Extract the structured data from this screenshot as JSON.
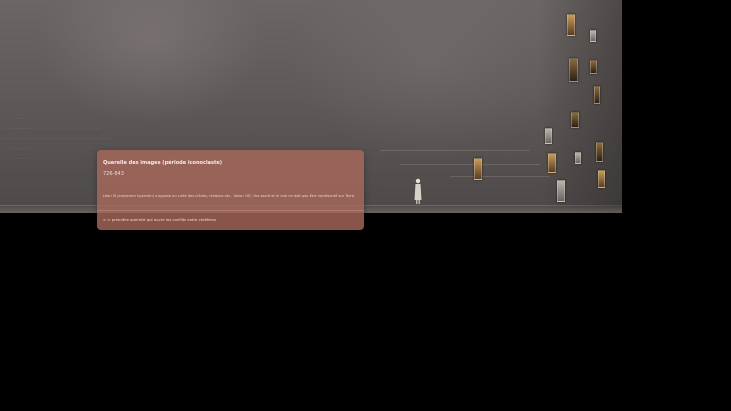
{
  "popup": {
    "title": "Querelle des images (période iconoclaste)",
    "dates": "726-843",
    "description": "Léon III (empereur byzantin) s'oppose au culte des icônes, reliques etc.. Selon l'AT, the sacré et le vrai ne doit pas être représenté sur Terre.",
    "link": "> > première querelle qui ouvre les conflits entre chrétiens"
  },
  "icons": {
    "timeline_figure": "standing-figure-icon",
    "event_thumbnails": "painting-thumbnail-icon"
  },
  "colors": {
    "popup_background": "#a7685c",
    "viewport_background": "#5f5a59",
    "page_background": "#000000"
  }
}
